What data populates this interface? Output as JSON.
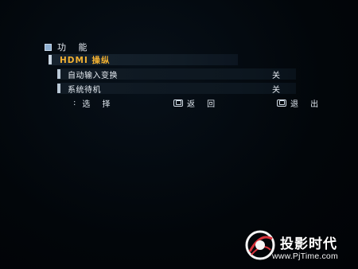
{
  "menu": {
    "title": "功 能",
    "selected_item": {
      "label": "HDMI 操纵"
    },
    "items": [
      {
        "label": "自动输入变换",
        "value": "关"
      },
      {
        "label": "系统待机",
        "value": "关"
      }
    ]
  },
  "footer": {
    "select": {
      "glyph": ":",
      "label": "选 择"
    },
    "back": {
      "label": "返 回",
      "icon": "return-button-icon"
    },
    "exit": {
      "label": "退 出",
      "icon": "exit-button-icon"
    }
  },
  "watermark": {
    "brand": "投影时代",
    "url": "www.PjTime.com"
  },
  "colors": {
    "background": "#02060a",
    "highlight_text": "#f2b132",
    "text": "#e7edf3",
    "watermark_accent": "#d8323c"
  }
}
